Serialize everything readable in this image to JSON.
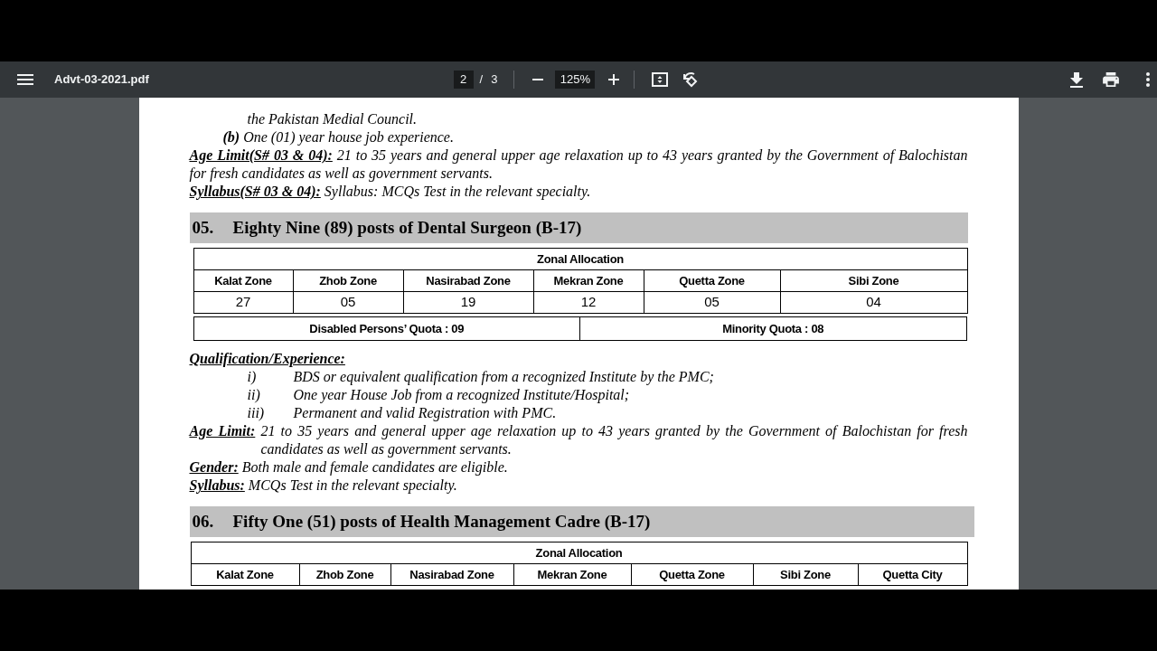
{
  "viewer": {
    "title": "Advt-03-2021.pdf",
    "page": "2",
    "page_separator": "/",
    "page_count": "3",
    "zoom": "125%"
  },
  "document": {
    "blocks": [
      {
        "kind": "continuation",
        "lines": [
          "the Pakistan Medial Council."
        ]
      },
      {
        "kind": "sub_item",
        "label": "(b)",
        "lines": [
          "One (01) year house job experience."
        ]
      },
      {
        "kind": "field",
        "label": "Age Limit(S# 03 & 04):",
        "lines": [
          "21 to 35 years and general upper age relaxation up to 43 years granted by the Government of Balochistan",
          "for fresh candidates as well as government servants."
        ]
      },
      {
        "kind": "field",
        "label": "Syllabus(S# 03 & 04):",
        "lines": [
          "Syllabus: MCQs Test in the relevant specialty."
        ]
      },
      {
        "kind": "section",
        "number": "05.",
        "title": "Eighty Nine (89) posts of Dental Surgeon (B-17)"
      },
      {
        "kind": "zonal_table",
        "title": "Zonal Allocation",
        "columns": [
          "Kalat Zone",
          "Zhob Zone",
          "Nasirabad Zone",
          "Mekran Zone",
          "Quetta Zone",
          "Sibi Zone"
        ],
        "rows": [
          [
            "27",
            "05",
            "19",
            "12",
            "05",
            "04"
          ]
        ]
      },
      {
        "kind": "quota_table",
        "cells": [
          "Disabled Persons’ Quota : 09",
          "Minority Quota : 08"
        ]
      },
      {
        "kind": "heading",
        "text": "Qualification/Experience:"
      },
      {
        "kind": "list_item",
        "numeral": "i)",
        "text": "BDS or equivalent qualification from a recognized Institute by the PMC;"
      },
      {
        "kind": "list_item",
        "numeral": "ii)",
        "text": "One year House Job from a recognized Institute/Hospital;"
      },
      {
        "kind": "list_item",
        "numeral": "iii)",
        "text": "Permanent and valid Registration with PMC."
      },
      {
        "kind": "field_hanging",
        "label": "Age Limit:",
        "lines": [
          "21 to 35 years and general upper age relaxation up to 43 years granted by the Government of Balochistan for fresh",
          "candidates as well as government servants."
        ]
      },
      {
        "kind": "field",
        "label": "Gender:",
        "lines": [
          "Both male and female candidates are eligible."
        ]
      },
      {
        "kind": "field",
        "label": "Syllabus:",
        "lines": [
          "MCQs Test in the relevant specialty."
        ]
      },
      {
        "kind": "section",
        "number": "06.",
        "title": "Fifty One (51) posts of Health Management Cadre (B-17)"
      },
      {
        "kind": "zonal_table",
        "title": "Zonal Allocation",
        "columns": [
          "Kalat Zone",
          "Zhob Zone",
          "Nasirabad Zone",
          "Mekran Zone",
          "Quetta Zone",
          "Sibi Zone",
          "Quetta City"
        ]
      }
    ]
  }
}
